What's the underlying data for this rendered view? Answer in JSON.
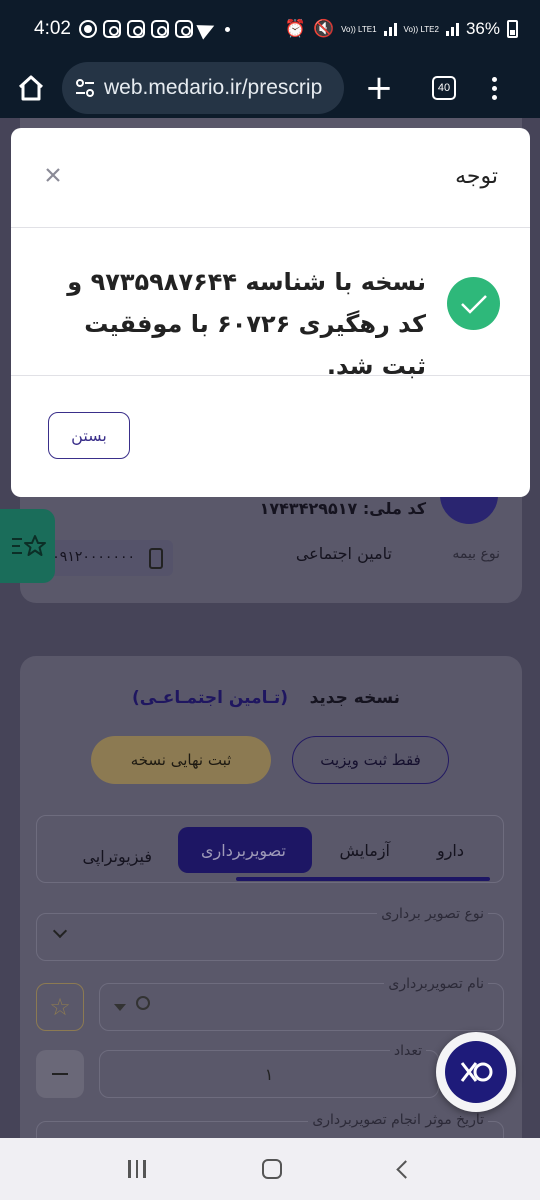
{
  "status_bar": {
    "time": "4:02",
    "sim1": "Vo)) LTE1",
    "sim2": "Vo)) LTE2",
    "battery": "36%"
  },
  "browser": {
    "url": "web.medario.ir/prescrip",
    "tab_count": "40"
  },
  "modal": {
    "title": "توجه",
    "message": "نسخه با شناسه ۹۷۳۵۹۸۷۶۴۴ و کد رهگیری ۶۰۷۲۶ با موفقیت ثبت شد.",
    "close_button": "بستن"
  },
  "background_page": {
    "patient": {
      "national_code": "کد ملی: ۱۷۴۳۴۲۹۵۱۷",
      "insurance_label": "نوع بیمه",
      "insurance_value": "تامین اجتماعی",
      "phone": "۰۹۱۲۰۰۰۰۰۰۰"
    },
    "prescription": {
      "title": "نسخه جدید",
      "insurance_tag": "(تـامین اجتمـاعـی)",
      "visit_only_button": "فقط ثبت ویزیت",
      "finalize_button": "ثبت نهایی نسخه",
      "tabs": [
        "دارو",
        "آزمایش",
        "تصویربرداری",
        "فیزیوتراپی"
      ],
      "active_tab": "تصویربرداری",
      "imaging_type_label": "نوع تصویر برداری",
      "imaging_name_label": "نام تصویربرداری",
      "count_label": "تعداد",
      "count_value": "۱",
      "date_label": "تاریخ موثر انجام تصویربرداری"
    }
  }
}
